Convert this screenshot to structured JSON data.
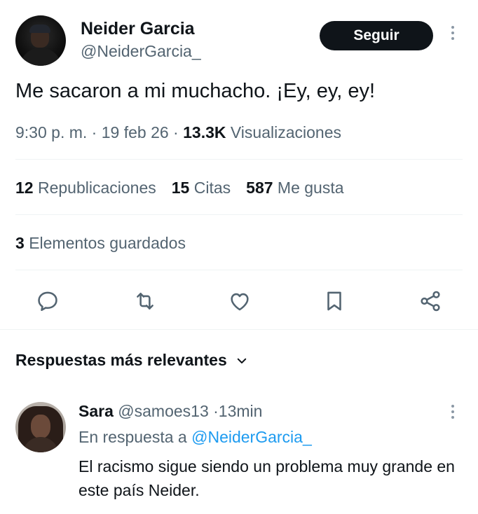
{
  "tweet": {
    "author_name": "Neider Garcia",
    "author_handle": "@NeiderGarcia_",
    "follow_label": "Seguir",
    "text": "Me sacaron a mi muchacho. ¡Ey, ey, ey!",
    "time": "9:30 p. m.",
    "separator": "·",
    "date": "19 feb 26",
    "views_count": "13.3K",
    "views_label": "Visualizaciones",
    "stats": {
      "reposts_count": "12",
      "reposts_label": "Republicaciones",
      "quotes_count": "15",
      "quotes_label": "Citas",
      "likes_count": "587",
      "likes_label": "Me gusta",
      "bookmarks_count": "3",
      "bookmarks_label": "Elementos guardados"
    },
    "actions": [
      "reply-icon",
      "repost-icon",
      "like-icon",
      "bookmark-icon",
      "share-icon"
    ]
  },
  "replies_section": {
    "sort_label": "Respuestas más relevantes"
  },
  "reply": {
    "author_name": "Sara",
    "author_handle": "@samoes13",
    "separator": "·",
    "time": "13min",
    "reply_to_label": "En respuesta a",
    "reply_to_handle": "@NeiderGarcia_",
    "text": "El racismo sigue siendo un problema muy grande en este país Neider."
  },
  "colors": {
    "text_primary": "#0f1419",
    "text_secondary": "#536471",
    "link": "#1d9bf0",
    "button_bg": "#0f1419",
    "divider": "#eff3f4"
  }
}
